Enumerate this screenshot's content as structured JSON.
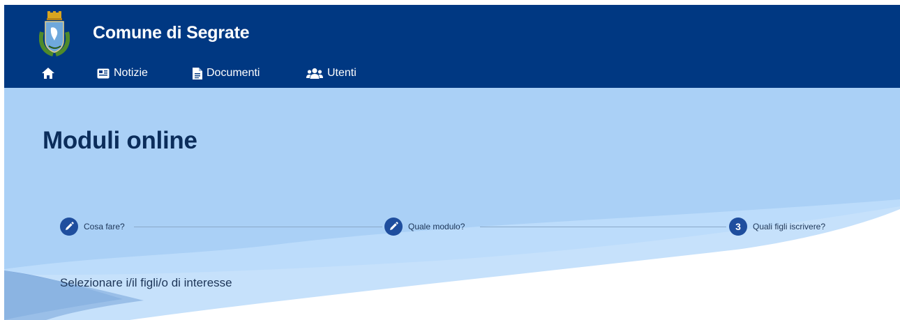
{
  "header": {
    "site_title": "Comune di Segrate",
    "logo_icon": "coat-of-arms-icon",
    "background_color": "#003882"
  },
  "nav": {
    "items": [
      {
        "icon": "home-icon",
        "label": ""
      },
      {
        "icon": "newspaper-icon",
        "label": "Notizie"
      },
      {
        "icon": "document-icon",
        "label": "Documenti"
      },
      {
        "icon": "users-icon",
        "label": "Utenti"
      }
    ]
  },
  "main": {
    "title": "Moduli online",
    "steps": [
      {
        "label": "Cosa fare?",
        "icon": "pencil-icon",
        "state": "completed"
      },
      {
        "label": "Quale modulo?",
        "icon": "pencil-icon",
        "state": "completed"
      },
      {
        "label": "Quali figli iscrivere?",
        "number": "3",
        "state": "current"
      }
    ],
    "instruction": "Selezionare i/il figli/o di interesse"
  },
  "colors": {
    "hero_background": "#aad0f6",
    "step_accent": "#1f4e9e",
    "title_text": "#0b2d5b"
  }
}
